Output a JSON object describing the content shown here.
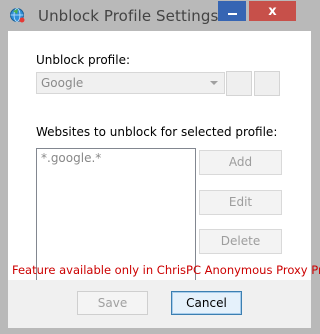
{
  "window": {
    "title": "Unblock Profile Settings",
    "minimize_icon": "minimize-icon",
    "close_icon": "close-x",
    "close_label": "x",
    "app_icon": "globe-network-icon"
  },
  "profile": {
    "label": "Unblock profile:",
    "selected": "Google"
  },
  "websites": {
    "label": "Websites to unblock for selected profile:",
    "items": [
      "*.google.*"
    ],
    "add_label": "Add",
    "edit_label": "Edit",
    "delete_label": "Delete"
  },
  "notice": {
    "text": "Feature available only in ChrisPC Anonymous Proxy Pro",
    "color": "#cc0000"
  },
  "footer": {
    "save_label": "Save",
    "cancel_label": "Cancel"
  },
  "colors": {
    "minimize_bg": "#3665b3",
    "close_bg": "#c7504a",
    "focus_border": "#3c7fb1"
  }
}
